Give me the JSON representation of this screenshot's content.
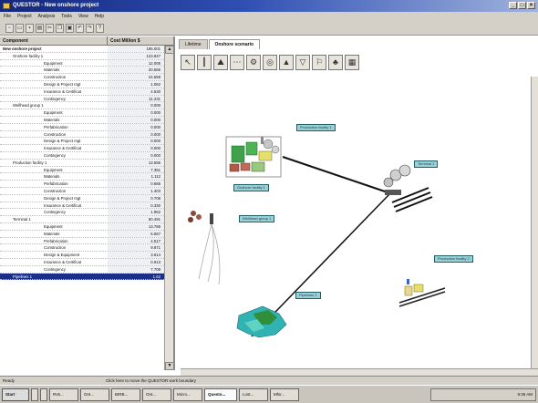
{
  "window": {
    "title": "QUESTOR - New onshore project"
  },
  "menu": [
    "File",
    "Project",
    "Analysis",
    "Tools",
    "View",
    "Help"
  ],
  "left_panel": {
    "columns": [
      "Component",
      "Cost Million $"
    ],
    "rows": [
      {
        "name": "New onshore project",
        "value": "195.001",
        "level": 0
      },
      {
        "name": "Onshore facility 1",
        "value": "123.947",
        "level": 1
      },
      {
        "name": "Equipment",
        "value": "12.005",
        "level": 2
      },
      {
        "name": "Materials",
        "value": "20.565",
        "level": 2
      },
      {
        "name": "Construction",
        "value": "24.558",
        "level": 2
      },
      {
        "name": "Design & Project mgt",
        "value": "1.062",
        "level": 2
      },
      {
        "name": "Insurance & Certificat",
        "value": "4.530",
        "level": 2
      },
      {
        "name": "Contingency",
        "value": "11.231",
        "level": 2
      },
      {
        "name": "Wellhead group 1",
        "value": "0.000",
        "level": 1
      },
      {
        "name": "Equipment",
        "value": "0.000",
        "level": 2
      },
      {
        "name": "Materials",
        "value": "0.000",
        "level": 2
      },
      {
        "name": "Prefabrication",
        "value": "0.000",
        "level": 2
      },
      {
        "name": "Construction",
        "value": "0.000",
        "level": 2
      },
      {
        "name": "Design & Project mgt",
        "value": "0.000",
        "level": 2
      },
      {
        "name": "Insurance & Certificat",
        "value": "0.000",
        "level": 2
      },
      {
        "name": "Contingency",
        "value": "0.000",
        "level": 2
      },
      {
        "name": "Production facility 1",
        "value": "13.555",
        "level": 1
      },
      {
        "name": "Equipment",
        "value": "7.351",
        "level": 2
      },
      {
        "name": "Materials",
        "value": "1.112",
        "level": 2
      },
      {
        "name": "Prefabrication",
        "value": "0.685",
        "level": 2
      },
      {
        "name": "Construction",
        "value": "1.403",
        "level": 2
      },
      {
        "name": "Design & Project mgt",
        "value": "0.708",
        "level": 2
      },
      {
        "name": "Insurance & Certificat",
        "value": "0.330",
        "level": 2
      },
      {
        "name": "Contingency",
        "value": "1.962",
        "level": 2
      },
      {
        "name": "Terminal 1",
        "value": "60.491",
        "level": 1
      },
      {
        "name": "Equipment",
        "value": "13.786",
        "level": 2
      },
      {
        "name": "Materials",
        "value": "6.567",
        "level": 2
      },
      {
        "name": "Prefabrication",
        "value": "4.517",
        "level": 2
      },
      {
        "name": "Construction",
        "value": "9.871",
        "level": 2
      },
      {
        "name": "Design & Equipment",
        "value": "3.614",
        "level": 2
      },
      {
        "name": "Insurance & Certificat",
        "value": "0.913",
        "level": 2
      },
      {
        "name": "Contingency",
        "value": "7.708",
        "level": 2
      },
      {
        "name": "Pipelines 1",
        "value": "1.62",
        "level": 1,
        "selected": true
      }
    ]
  },
  "tabs": [
    "Lifetime",
    "Onshore scenario"
  ],
  "toolbar_icons": [
    "select-tool-icon",
    "wellhead-icon",
    "terrain-icon",
    "pipeline-icon",
    "plant-icon",
    "compressor-icon",
    "platform-icon",
    "tank-icon",
    "terminal-icon",
    "landscape-icon",
    "map-icon"
  ],
  "canvas_labels": {
    "production_facility": "Production facility 1",
    "onshore_facility": "Onshore facility 1",
    "terminal": "Terminal 1",
    "wellhead": "Wellhead group 1",
    "production_facility_2": "Production facility 2",
    "pipelines": "Pipelines 1"
  },
  "status": {
    "left": "Ready",
    "message": "Click here to move the QUESTOR work boundary"
  },
  "taskbar": {
    "start": "Start",
    "tasks": [
      "Rv5...",
      "Ont...",
      "BIRB...",
      "Ont...",
      "Micro...",
      "Questo...",
      "Lost...",
      "Mfsr..."
    ],
    "tray_time": "9:35 AM"
  }
}
